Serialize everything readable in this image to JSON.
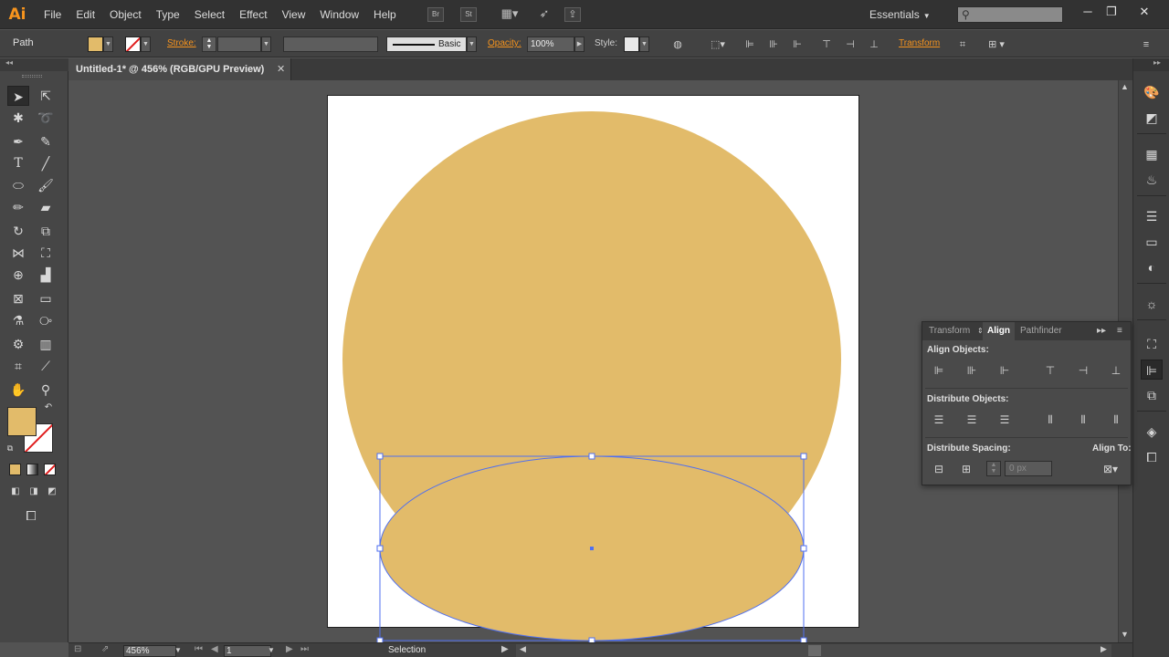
{
  "app": {
    "logo_text": "Ai",
    "menus": [
      "File",
      "Edit",
      "Object",
      "Type",
      "Select",
      "Effect",
      "View",
      "Window",
      "Help"
    ],
    "workspace": "Essentials",
    "bridge_label": "Br",
    "stock_label": "St"
  },
  "control_bar": {
    "selection_type": "Path",
    "fill_color": "#e2bb6a",
    "stroke_label": "Stroke:",
    "brush_label": "Basic",
    "opacity_label": "Opacity:",
    "opacity_value": "100%",
    "style_label": "Style:",
    "transform_label": "Transform"
  },
  "document": {
    "tab_title": "Untitled-1* @ 456% (RGB/GPU Preview)",
    "close_glyph": "✕"
  },
  "artwork": {
    "fill_color": "#e2bb6a",
    "selection_color": "#4f6ff0",
    "artboard_color": "#ffffff"
  },
  "align_panel": {
    "tabs": [
      "Transform",
      "Align",
      "Pathfinder"
    ],
    "active_tab": "Align",
    "align_objects_label": "Align Objects:",
    "distribute_objects_label": "Distribute Objects:",
    "distribute_spacing_label": "Distribute Spacing:",
    "align_to_label": "Align To:",
    "spacing_placeholder": "0 px"
  },
  "status_bar": {
    "zoom": "456%",
    "artboard_number": "1",
    "current_tool": "Selection"
  }
}
